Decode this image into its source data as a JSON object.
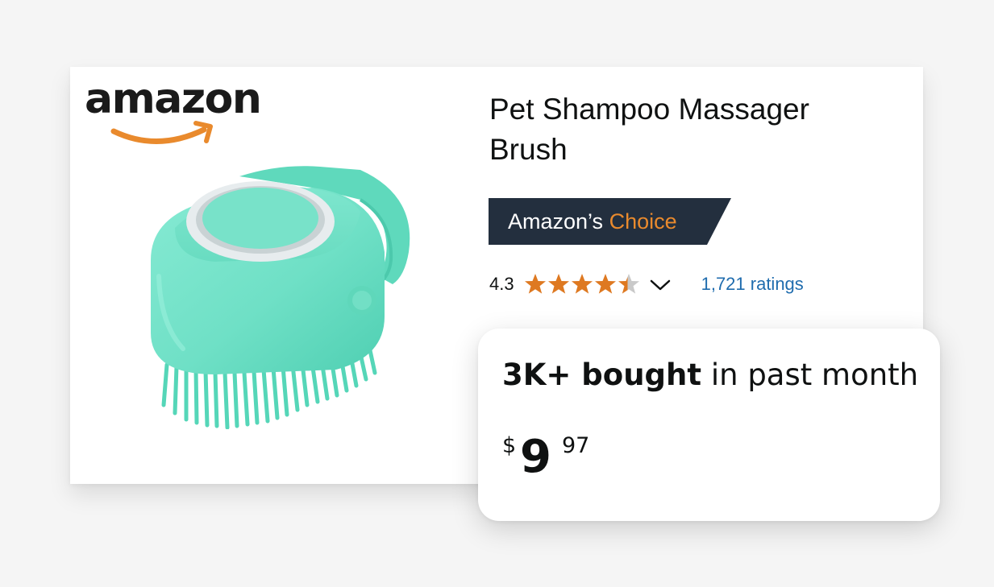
{
  "brand": {
    "logo_text": "amazon",
    "logo_icon": "amazon-smile-arrow-icon"
  },
  "product": {
    "image": "teal-silicone-pet-shampoo-brush",
    "title": "Pet Shampoo Massager Brush"
  },
  "badge": {
    "prefix": "Amazon’s",
    "accent": "Choice"
  },
  "rating": {
    "value": "4.3",
    "stars_out_of_5": 4.3,
    "dropdown_icon": "chevron-down-icon",
    "count_link": "1,721 ratings"
  },
  "popup": {
    "bought_bold": "3K+ bought",
    "bought_rest": " in past month",
    "price_symbol": "$",
    "price_whole": "9",
    "price_fraction": "97"
  },
  "colors": {
    "background": "#f5f5f5",
    "badge_bg": "#232f3e",
    "badge_accent": "#e98a2d",
    "star": "#de7921",
    "star_empty": "#c9c9c9",
    "link": "#1f6cae",
    "text": "#0f1111",
    "product_teal": "#6fe0c6"
  }
}
